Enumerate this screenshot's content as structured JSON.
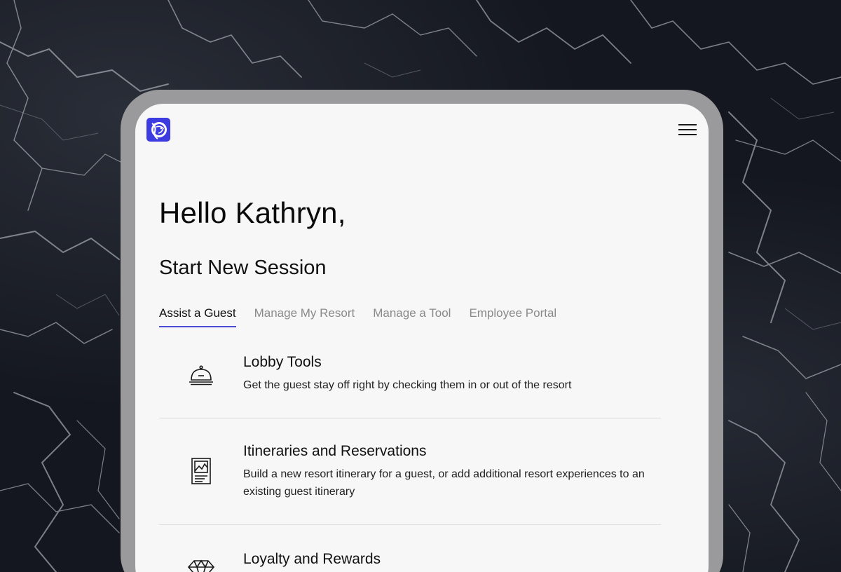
{
  "brand": {
    "accent": "#3c3ce0",
    "logo_icon": "lion-logo-icon"
  },
  "header": {
    "menu_icon": "hamburger-menu-icon"
  },
  "greeting": "Hello Kathryn,",
  "section_title": "Start New Session",
  "tabs": [
    {
      "label": "Assist a Guest",
      "active": true
    },
    {
      "label": "Manage My Resort",
      "active": false
    },
    {
      "label": "Manage a Tool",
      "active": false
    },
    {
      "label": "Employee Portal",
      "active": false
    }
  ],
  "items": [
    {
      "icon": "service-bell-icon",
      "title": "Lobby Tools",
      "description": "Get the guest stay off right by checking them in or out of the resort"
    },
    {
      "icon": "itinerary-document-icon",
      "title": "Itineraries and Reservations",
      "description": "Build a new resort itinerary for a guest, or add additional resort experiences to an existing guest itinerary"
    },
    {
      "icon": "diamond-icon",
      "title": "Loyalty and Rewards",
      "description": ""
    }
  ]
}
